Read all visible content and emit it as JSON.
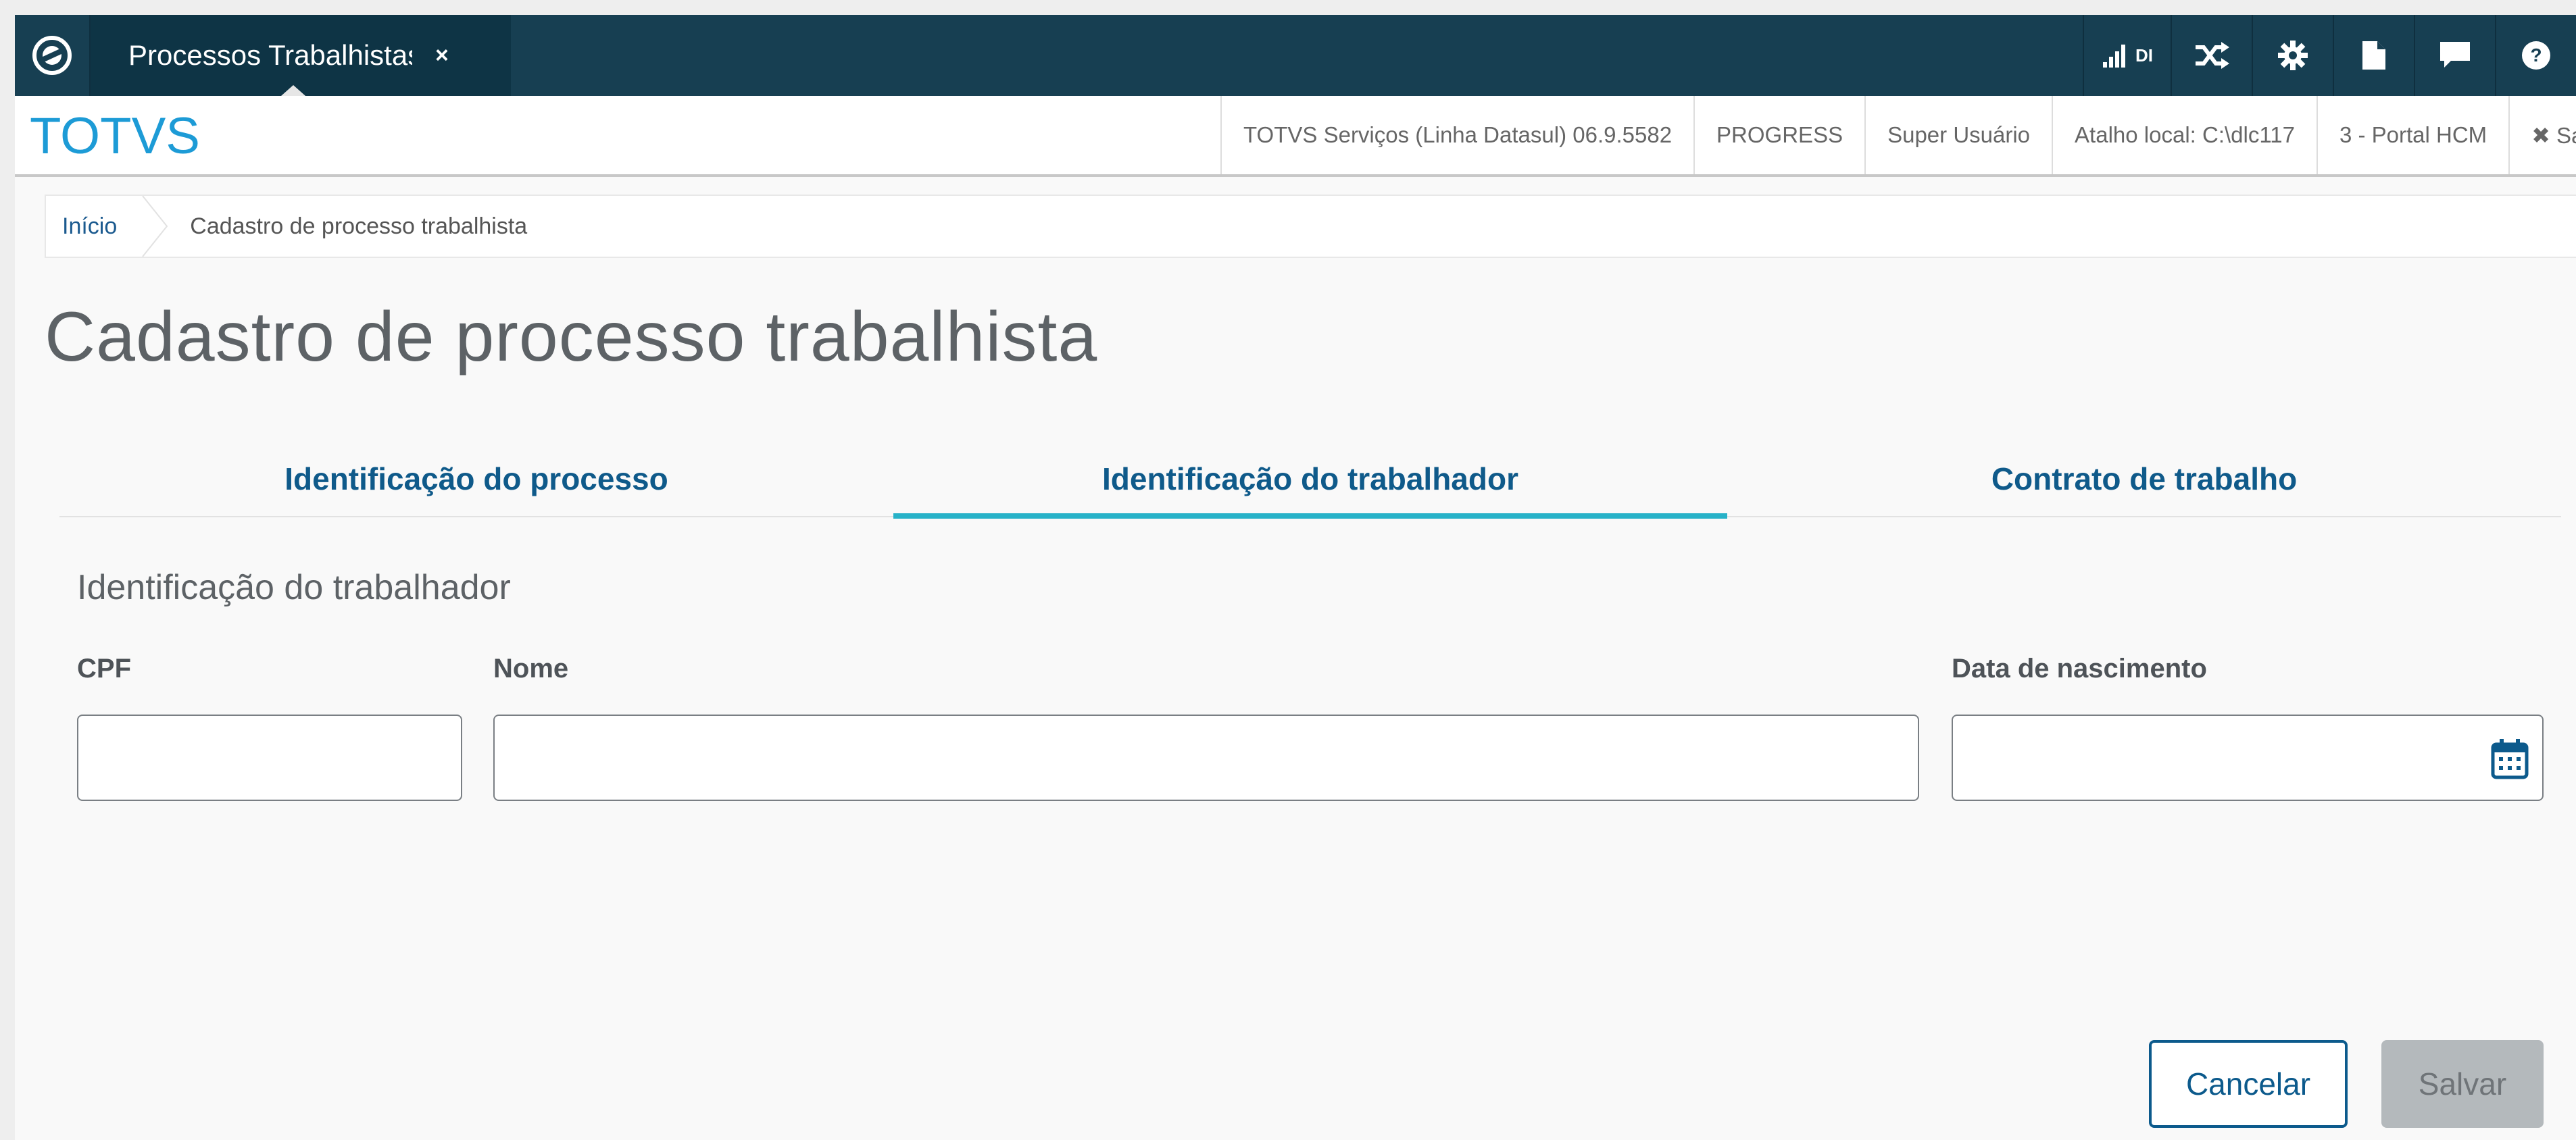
{
  "topbar": {
    "tab_title": "Processos Trabalhistas",
    "tab_close": "×",
    "signal_label": "DI",
    "icons": [
      "signal-icon",
      "shuffle-icon",
      "gear-icon",
      "document-icon",
      "chat-icon",
      "help-icon"
    ]
  },
  "header": {
    "brand": "TOTVS",
    "info_items": [
      "TOTVS Serviços (Linha Datasul) 06.9.5582",
      "PROGRESS",
      "Super Usuário",
      "Atalho local: C:\\dlc117",
      "3 - Portal HCM",
      "✖ Sair"
    ]
  },
  "breadcrumb": {
    "home": "Início",
    "current": "Cadastro de processo trabalhista"
  },
  "page": {
    "title": "Cadastro de processo trabalhista",
    "tabs": [
      {
        "label": "Identificação do processo",
        "active": false
      },
      {
        "label": "Identificação do trabalhador",
        "active": true
      },
      {
        "label": "Contrato de trabalho",
        "active": false
      }
    ],
    "section_title": "Identificação do trabalhador"
  },
  "form": {
    "cpf": {
      "label": "CPF",
      "value": ""
    },
    "nome": {
      "label": "Nome",
      "value": ""
    },
    "data_nascimento": {
      "label": "Data de nascimento",
      "value": ""
    }
  },
  "actions": {
    "cancel": "Cancelar",
    "save": "Salvar"
  },
  "colors": {
    "topbar": "#173f52",
    "brand": "#1d9bd6",
    "accent_tab": "#27b2c8",
    "primary": "#0c5a8c"
  }
}
